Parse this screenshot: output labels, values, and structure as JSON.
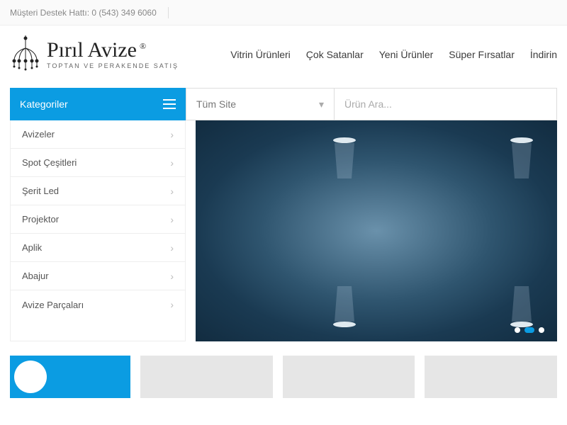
{
  "topbar": {
    "support": "Müşteri Destek Hattı: 0 (543) 349 6060"
  },
  "logo": {
    "script": "Pırıl Avize",
    "reg": "®",
    "tag": "TOPTAN VE PERAKENDE SATIŞ"
  },
  "nav": [
    "Vitrin Ürünleri",
    "Çok Satanlar",
    "Yeni Ürünler",
    "Süper Fırsatlar",
    "İndirin"
  ],
  "categories": {
    "title": "Kategoriler",
    "items": [
      "Avizeler",
      "Spot Çeşitleri",
      "Şerit Led",
      "Projektor",
      "Aplik",
      "Abajur",
      "Avize Parçaları"
    ]
  },
  "search": {
    "select": "Tüm Site",
    "placeholder": "Ürün Ara..."
  },
  "carousel": {
    "active_index": 1,
    "total": 3
  }
}
